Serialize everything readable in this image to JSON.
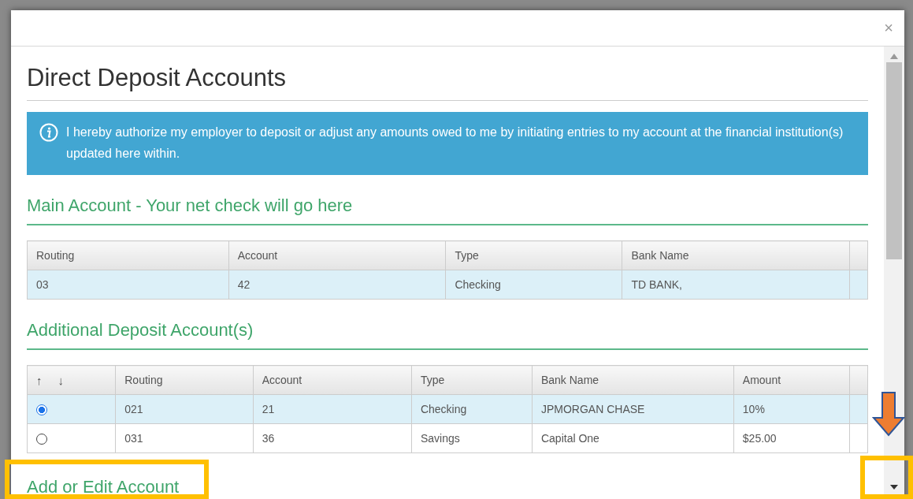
{
  "dialog": {
    "close": "×",
    "title": "Direct Deposit Accounts",
    "notice": "I hereby authorize my employer to deposit or adjust any amounts owed to me by initiating entries to my account at the financial institution(s) updated here within."
  },
  "main_account": {
    "heading": "Main Account - Your net check will go here",
    "columns": [
      "Routing",
      "Account",
      "Type",
      "Bank Name"
    ],
    "rows": [
      {
        "cells": [
          "03",
          "42",
          "Checking",
          "TD BANK,"
        ],
        "selected": true
      }
    ]
  },
  "additional_accounts": {
    "heading": "Additional Deposit Account(s)",
    "sort_up": "↑",
    "sort_down": "↓",
    "columns": [
      "Routing",
      "Account",
      "Type",
      "Bank Name",
      "Amount"
    ],
    "rows": [
      {
        "cells": [
          "021",
          "21",
          "Checking",
          "JPMORGAN CHASE",
          "10%"
        ],
        "selected": true
      },
      {
        "cells": [
          "031",
          "36",
          "Savings",
          "Capital One",
          "$25.00"
        ],
        "selected": false
      }
    ]
  },
  "add_edit_heading": "Add or Edit Account"
}
